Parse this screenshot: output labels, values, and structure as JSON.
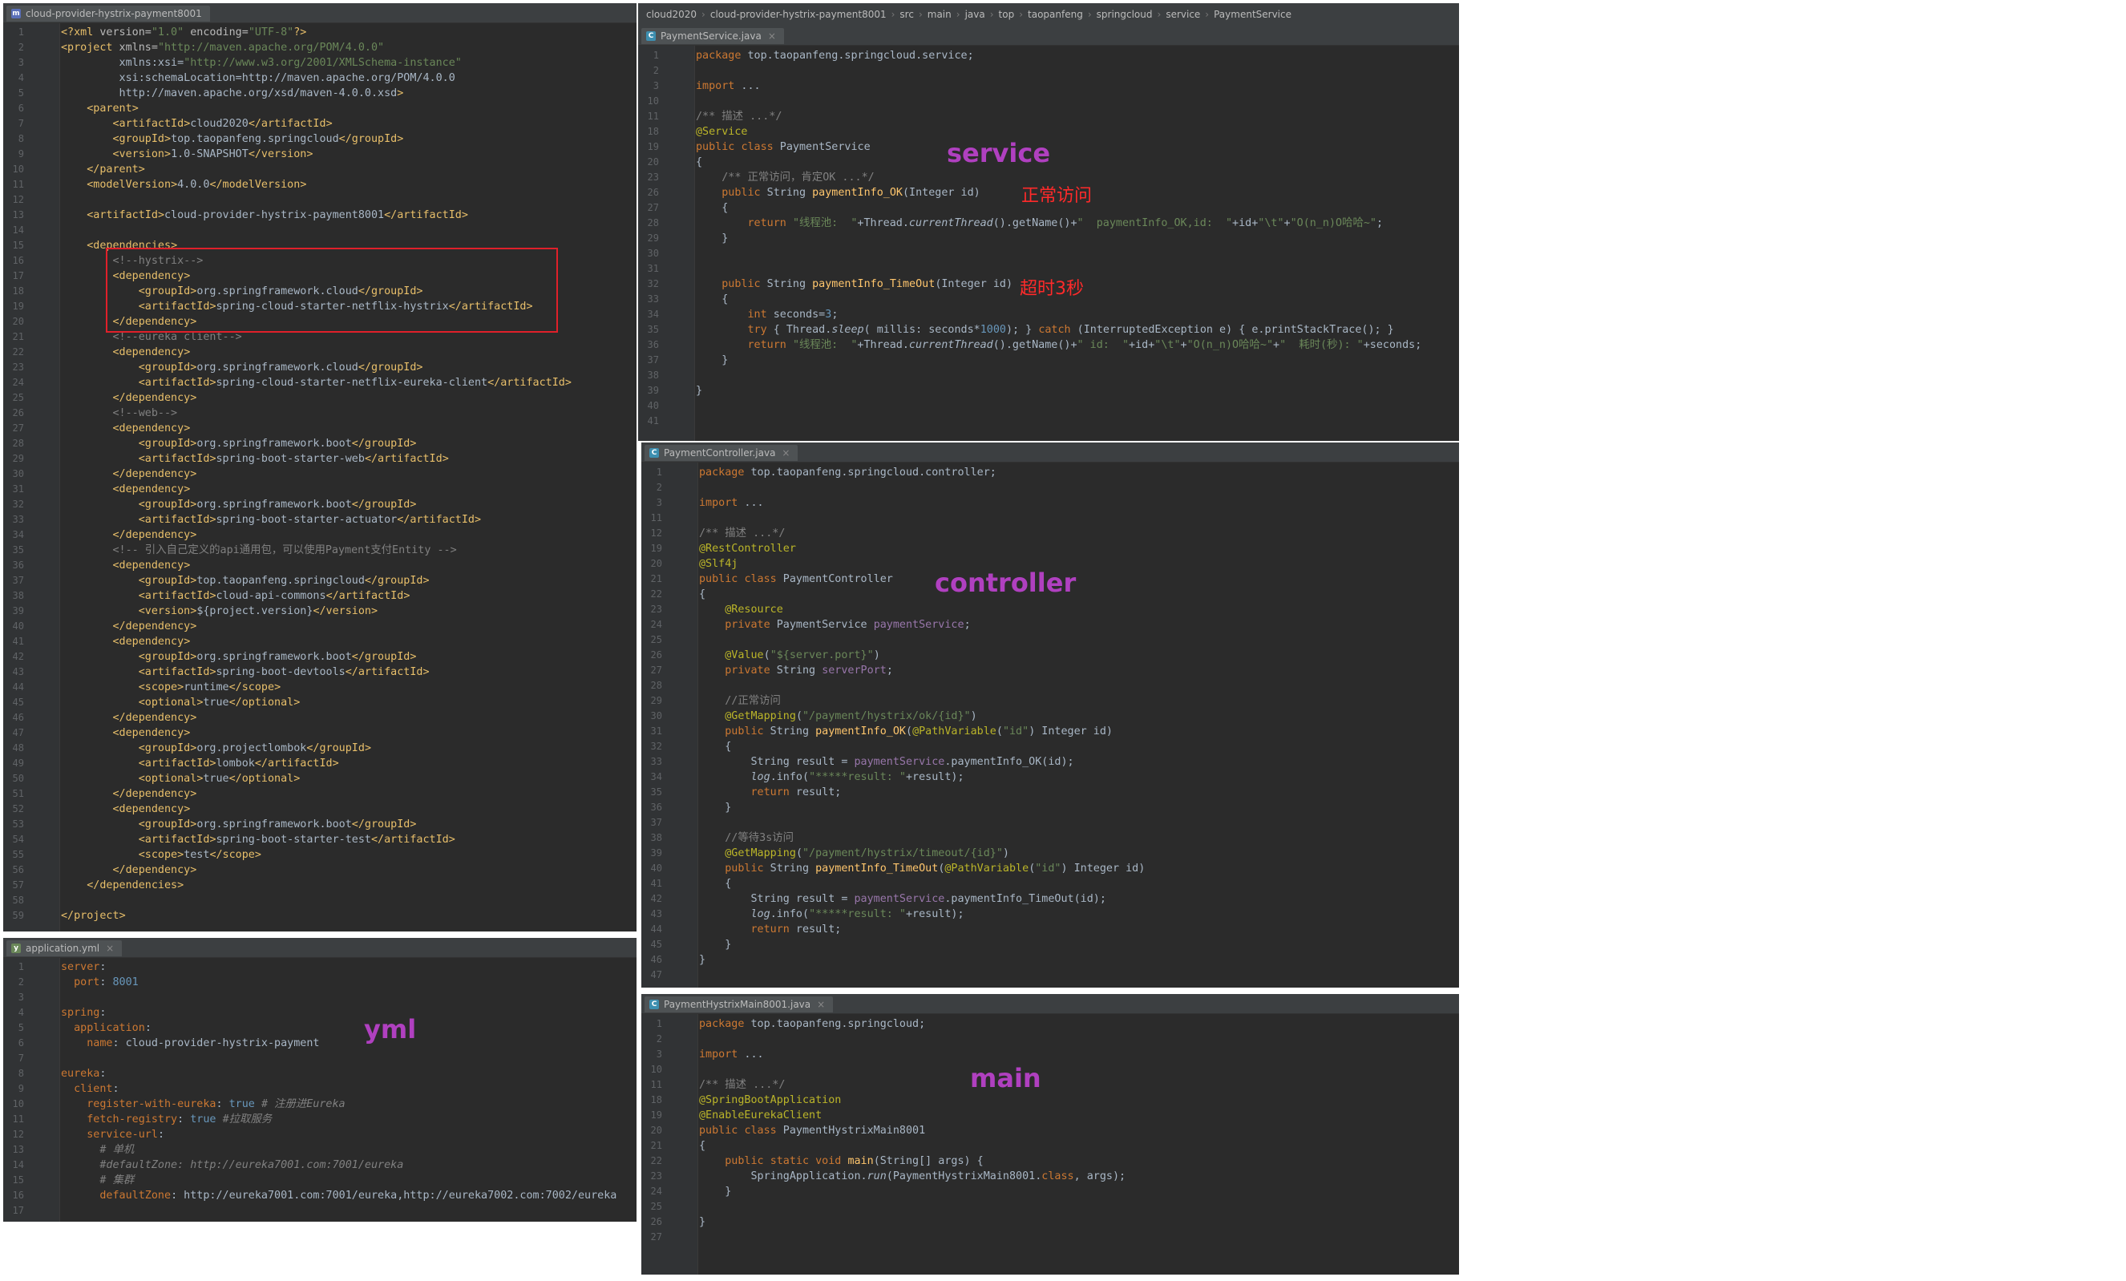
{
  "pom": {
    "tab": "cloud-provider-hystrix-payment8001",
    "lines": [
      [
        "1",
        "<?xml version=\"1.0\" encoding=\"UTF-8\"?>"
      ],
      [
        "2",
        "<project xmlns=\"http://maven.apache.org/POM/4.0.0\""
      ],
      [
        "3",
        "         xmlns:xsi=\"http://www.w3.org/2001/XMLSchema-instance\""
      ],
      [
        "4",
        "         xsi:schemaLocation=\"http://maven.apache.org/POM/4.0.0"
      ],
      [
        "5",
        "         http://maven.apache.org/xsd/maven-4.0.0.xsd\">"
      ],
      [
        "6",
        "    <parent>"
      ],
      [
        "7",
        "        <artifactId>cloud2020</artifactId>"
      ],
      [
        "8",
        "        <groupId>top.taopanfeng.springcloud</groupId>"
      ],
      [
        "9",
        "        <version>1.0-SNAPSHOT</version>"
      ],
      [
        "10",
        "    </parent>"
      ],
      [
        "11",
        "    <modelVersion>4.0.0</modelVersion>"
      ],
      [
        "12",
        ""
      ],
      [
        "13",
        "    <artifactId>cloud-provider-hystrix-payment8001</artifactId>"
      ],
      [
        "14",
        ""
      ],
      [
        "15",
        "    <dependencies>"
      ],
      [
        "16",
        "        <!--hystrix-->"
      ],
      [
        "17",
        "        <dependency>"
      ],
      [
        "18",
        "            <groupId>org.springframework.cloud</groupId>"
      ],
      [
        "19",
        "            <artifactId>spring-cloud-starter-netflix-hystrix</artifactId>"
      ],
      [
        "20",
        "        </dependency>"
      ],
      [
        "21",
        "        <!--eureka client-->"
      ],
      [
        "22",
        "        <dependency>"
      ],
      [
        "23",
        "            <groupId>org.springframework.cloud</groupId>"
      ],
      [
        "24",
        "            <artifactId>spring-cloud-starter-netflix-eureka-client</artifactId>"
      ],
      [
        "25",
        "        </dependency>"
      ],
      [
        "26",
        "        <!--web-->"
      ],
      [
        "27",
        "        <dependency>"
      ],
      [
        "28",
        "            <groupId>org.springframework.boot</groupId>"
      ],
      [
        "29",
        "            <artifactId>spring-boot-starter-web</artifactId>"
      ],
      [
        "30",
        "        </dependency>"
      ],
      [
        "31",
        "        <dependency>"
      ],
      [
        "32",
        "            <groupId>org.springframework.boot</groupId>"
      ],
      [
        "33",
        "            <artifactId>spring-boot-starter-actuator</artifactId>"
      ],
      [
        "34",
        "        </dependency>"
      ],
      [
        "35",
        "        <!-- 引入自己定义的api通用包，可以使用Payment支付Entity -->"
      ],
      [
        "36",
        "        <dependency>"
      ],
      [
        "37",
        "            <groupId>top.taopanfeng.springcloud</groupId>"
      ],
      [
        "38",
        "            <artifactId>cloud-api-commons</artifactId>"
      ],
      [
        "39",
        "            <version>${project.version}</version>"
      ],
      [
        "40",
        "        </dependency>"
      ],
      [
        "41",
        "        <dependency>"
      ],
      [
        "42",
        "            <groupId>org.springframework.boot</groupId>"
      ],
      [
        "43",
        "            <artifactId>spring-boot-devtools</artifactId>"
      ],
      [
        "44",
        "            <scope>runtime</scope>"
      ],
      [
        "45",
        "            <optional>true</optional>"
      ],
      [
        "46",
        "        </dependency>"
      ],
      [
        "47",
        "        <dependency>"
      ],
      [
        "48",
        "            <groupId>org.projectlombok</groupId>"
      ],
      [
        "49",
        "            <artifactId>lombok</artifactId>"
      ],
      [
        "50",
        "            <optional>true</optional>"
      ],
      [
        "51",
        "        </dependency>"
      ],
      [
        "52",
        "        <dependency>"
      ],
      [
        "53",
        "            <groupId>org.springframework.boot</groupId>"
      ],
      [
        "54",
        "            <artifactId>spring-boot-starter-test</artifactId>"
      ],
      [
        "55",
        "            <scope>test</scope>"
      ],
      [
        "56",
        "        </dependency>"
      ],
      [
        "57",
        "    </dependencies>"
      ],
      [
        "58",
        ""
      ],
      [
        "59",
        "</project>"
      ]
    ]
  },
  "yml": {
    "tab": "application.yml",
    "overlay": "yml",
    "lines": [
      [
        "1",
        "server:"
      ],
      [
        "2",
        "  port: 8001"
      ],
      [
        "3",
        ""
      ],
      [
        "4",
        "spring:"
      ],
      [
        "5",
        "  application:"
      ],
      [
        "6",
        "    name: cloud-provider-hystrix-payment"
      ],
      [
        "7",
        ""
      ],
      [
        "8",
        "eureka:"
      ],
      [
        "9",
        "  client:"
      ],
      [
        "10",
        "    register-with-eureka: true # 注册进Eureka"
      ],
      [
        "11",
        "    fetch-registry: true #拉取服务"
      ],
      [
        "12",
        "    service-url:"
      ],
      [
        "13",
        "      # 单机"
      ],
      [
        "14",
        "      #defaultZone: http://eureka7001.com:7001/eureka"
      ],
      [
        "15",
        "      # 集群"
      ],
      [
        "16",
        "      defaultZone: http://eureka7001.com:7001/eureka,http://eureka7002.com:7002/eureka"
      ],
      [
        "17",
        ""
      ]
    ]
  },
  "service": {
    "breadcrumb": [
      "cloud2020",
      "cloud-provider-hystrix-payment8001",
      "src",
      "main",
      "java",
      "top",
      "taopanfeng",
      "springcloud",
      "service",
      "PaymentService"
    ],
    "tab": "PaymentService.java",
    "overlay": "service",
    "note_ok": "正常访问",
    "note_timeout": "超时3秒",
    "lines": [
      [
        "1",
        "package top.taopanfeng.springcloud.service;"
      ],
      [
        "2",
        ""
      ],
      [
        "3",
        "import ..."
      ],
      [
        "10",
        ""
      ],
      [
        "11",
        "/** 描述 ...*/"
      ],
      [
        "18",
        "@Service"
      ],
      [
        "19",
        "public class PaymentService"
      ],
      [
        "20",
        "{"
      ],
      [
        "23",
        "    /** 正常访问，肯定OK ...*/"
      ],
      [
        "26",
        "    public String paymentInfo_OK(Integer id)"
      ],
      [
        "27",
        "    {"
      ],
      [
        "28",
        "        return \"线程池:  \"+Thread.currentThread().getName()+\"  paymentInfo_OK,id:  \"+id+\"\\t\"+\"O(n_n)O哈哈~\";"
      ],
      [
        "29",
        "    }"
      ],
      [
        "30",
        ""
      ],
      [
        "31",
        ""
      ],
      [
        "32",
        "    public String paymentInfo_TimeOut(Integer id)"
      ],
      [
        "33",
        "    {"
      ],
      [
        "34",
        "        int seconds=3;"
      ],
      [
        "35",
        "        try { Thread.sleep( millis: seconds*1000); } catch (InterruptedException e) { e.printStackTrace(); }"
      ],
      [
        "36",
        "        return \"线程池:  \"+Thread.currentThread().getName()+\" id:  \"+id+\"\\t\"+\"O(n_n)O哈哈~\"+\"  耗时(秒): \"+seconds;"
      ],
      [
        "37",
        "    }"
      ],
      [
        "38",
        ""
      ],
      [
        "39",
        "}"
      ],
      [
        "40",
        ""
      ],
      [
        "41",
        ""
      ]
    ]
  },
  "controller": {
    "tab": "PaymentController.java",
    "overlay": "controller",
    "lines": [
      [
        "1",
        "package top.taopanfeng.springcloud.controller;"
      ],
      [
        "2",
        ""
      ],
      [
        "3",
        "import ..."
      ],
      [
        "11",
        ""
      ],
      [
        "12",
        "/** 描述 ...*/"
      ],
      [
        "19",
        "@RestController"
      ],
      [
        "20",
        "@Slf4j"
      ],
      [
        "21",
        "public class PaymentController"
      ],
      [
        "22",
        "{"
      ],
      [
        "23",
        "    @Resource"
      ],
      [
        "24",
        "    private PaymentService paymentService;"
      ],
      [
        "25",
        ""
      ],
      [
        "26",
        "    @Value(\"${server.port}\")"
      ],
      [
        "27",
        "    private String serverPort;"
      ],
      [
        "28",
        ""
      ],
      [
        "29",
        "    //正常访问"
      ],
      [
        "30",
        "    @GetMapping(\"/payment/hystrix/ok/{id}\")"
      ],
      [
        "31",
        "    public String paymentInfo_OK(@PathVariable(\"id\") Integer id)"
      ],
      [
        "32",
        "    {"
      ],
      [
        "33",
        "        String result = paymentService.paymentInfo_OK(id);"
      ],
      [
        "34",
        "        log.info(\"*****result: \"+result);"
      ],
      [
        "35",
        "        return result;"
      ],
      [
        "36",
        "    }"
      ],
      [
        "37",
        ""
      ],
      [
        "38",
        "    //等待3s访问"
      ],
      [
        "39",
        "    @GetMapping(\"/payment/hystrix/timeout/{id}\")"
      ],
      [
        "40",
        "    public String paymentInfo_TimeOut(@PathVariable(\"id\") Integer id)"
      ],
      [
        "41",
        "    {"
      ],
      [
        "42",
        "        String result = paymentService.paymentInfo_TimeOut(id);"
      ],
      [
        "43",
        "        log.info(\"*****result: \"+result);"
      ],
      [
        "44",
        "        return result;"
      ],
      [
        "45",
        "    }"
      ],
      [
        "46",
        "}"
      ],
      [
        "47",
        ""
      ]
    ]
  },
  "main": {
    "tab": "PaymentHystrixMain8001.java",
    "overlay": "main",
    "lines": [
      [
        "1",
        "package top.taopanfeng.springcloud;"
      ],
      [
        "2",
        ""
      ],
      [
        "3",
        "import ..."
      ],
      [
        "10",
        ""
      ],
      [
        "11",
        "/** 描述 ...*/"
      ],
      [
        "18",
        "@SpringBootApplication"
      ],
      [
        "19",
        "@EnableEurekaClient"
      ],
      [
        "20",
        "public class PaymentHystrixMain8001"
      ],
      [
        "21",
        "{"
      ],
      [
        "22",
        "    public static void main(String[] args) {"
      ],
      [
        "23",
        "        SpringApplication.run(PaymentHystrixMain8001.class, args);"
      ],
      [
        "24",
        "    }"
      ],
      [
        "25",
        ""
      ],
      [
        "26",
        "}"
      ],
      [
        "27",
        ""
      ]
    ]
  },
  "colors": {
    "editor_bg": "#2b2b2b",
    "overlay_purple": "#b040c0",
    "overlay_red": "#ff2a2a",
    "highlight_box": "#e0202a"
  }
}
